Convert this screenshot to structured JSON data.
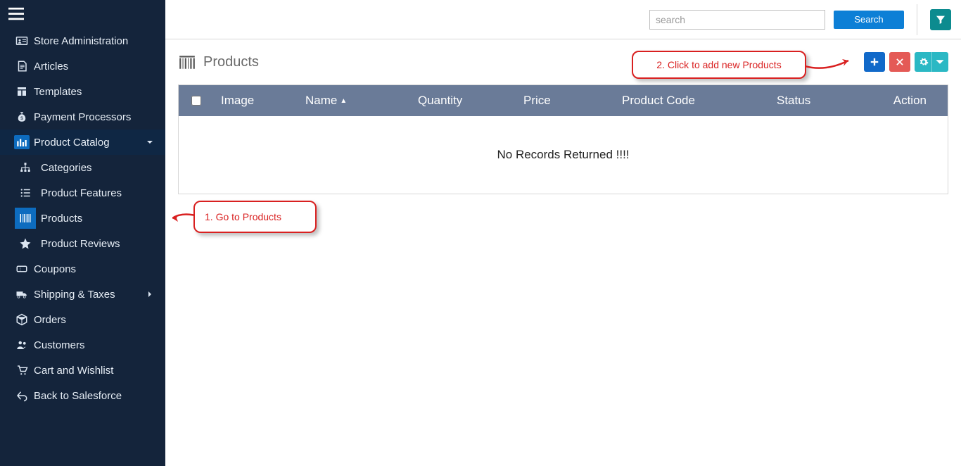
{
  "search": {
    "placeholder": "search",
    "button": "Search"
  },
  "sidebar": {
    "items": [
      {
        "label": "Store Administration"
      },
      {
        "label": "Articles"
      },
      {
        "label": "Templates"
      },
      {
        "label": "Payment Processors"
      },
      {
        "label": "Product Catalog"
      },
      {
        "label": "Coupons"
      },
      {
        "label": "Shipping & Taxes"
      },
      {
        "label": "Orders"
      },
      {
        "label": "Customers"
      },
      {
        "label": "Cart and Wishlist"
      },
      {
        "label": "Back to Salesforce"
      }
    ],
    "catalog_sub": [
      {
        "label": "Categories"
      },
      {
        "label": "Product Features"
      },
      {
        "label": "Products"
      },
      {
        "label": "Product Reviews"
      }
    ]
  },
  "page": {
    "title": "Products"
  },
  "table": {
    "columns": {
      "image": "Image",
      "name": "Name",
      "quantity": "Quantity",
      "price": "Price",
      "code": "Product Code",
      "status": "Status",
      "action": "Action"
    },
    "empty": "No Records Returned !!!!"
  },
  "callouts": {
    "c1": "1. Go to Products",
    "c2": "2. Click to add new Products"
  }
}
